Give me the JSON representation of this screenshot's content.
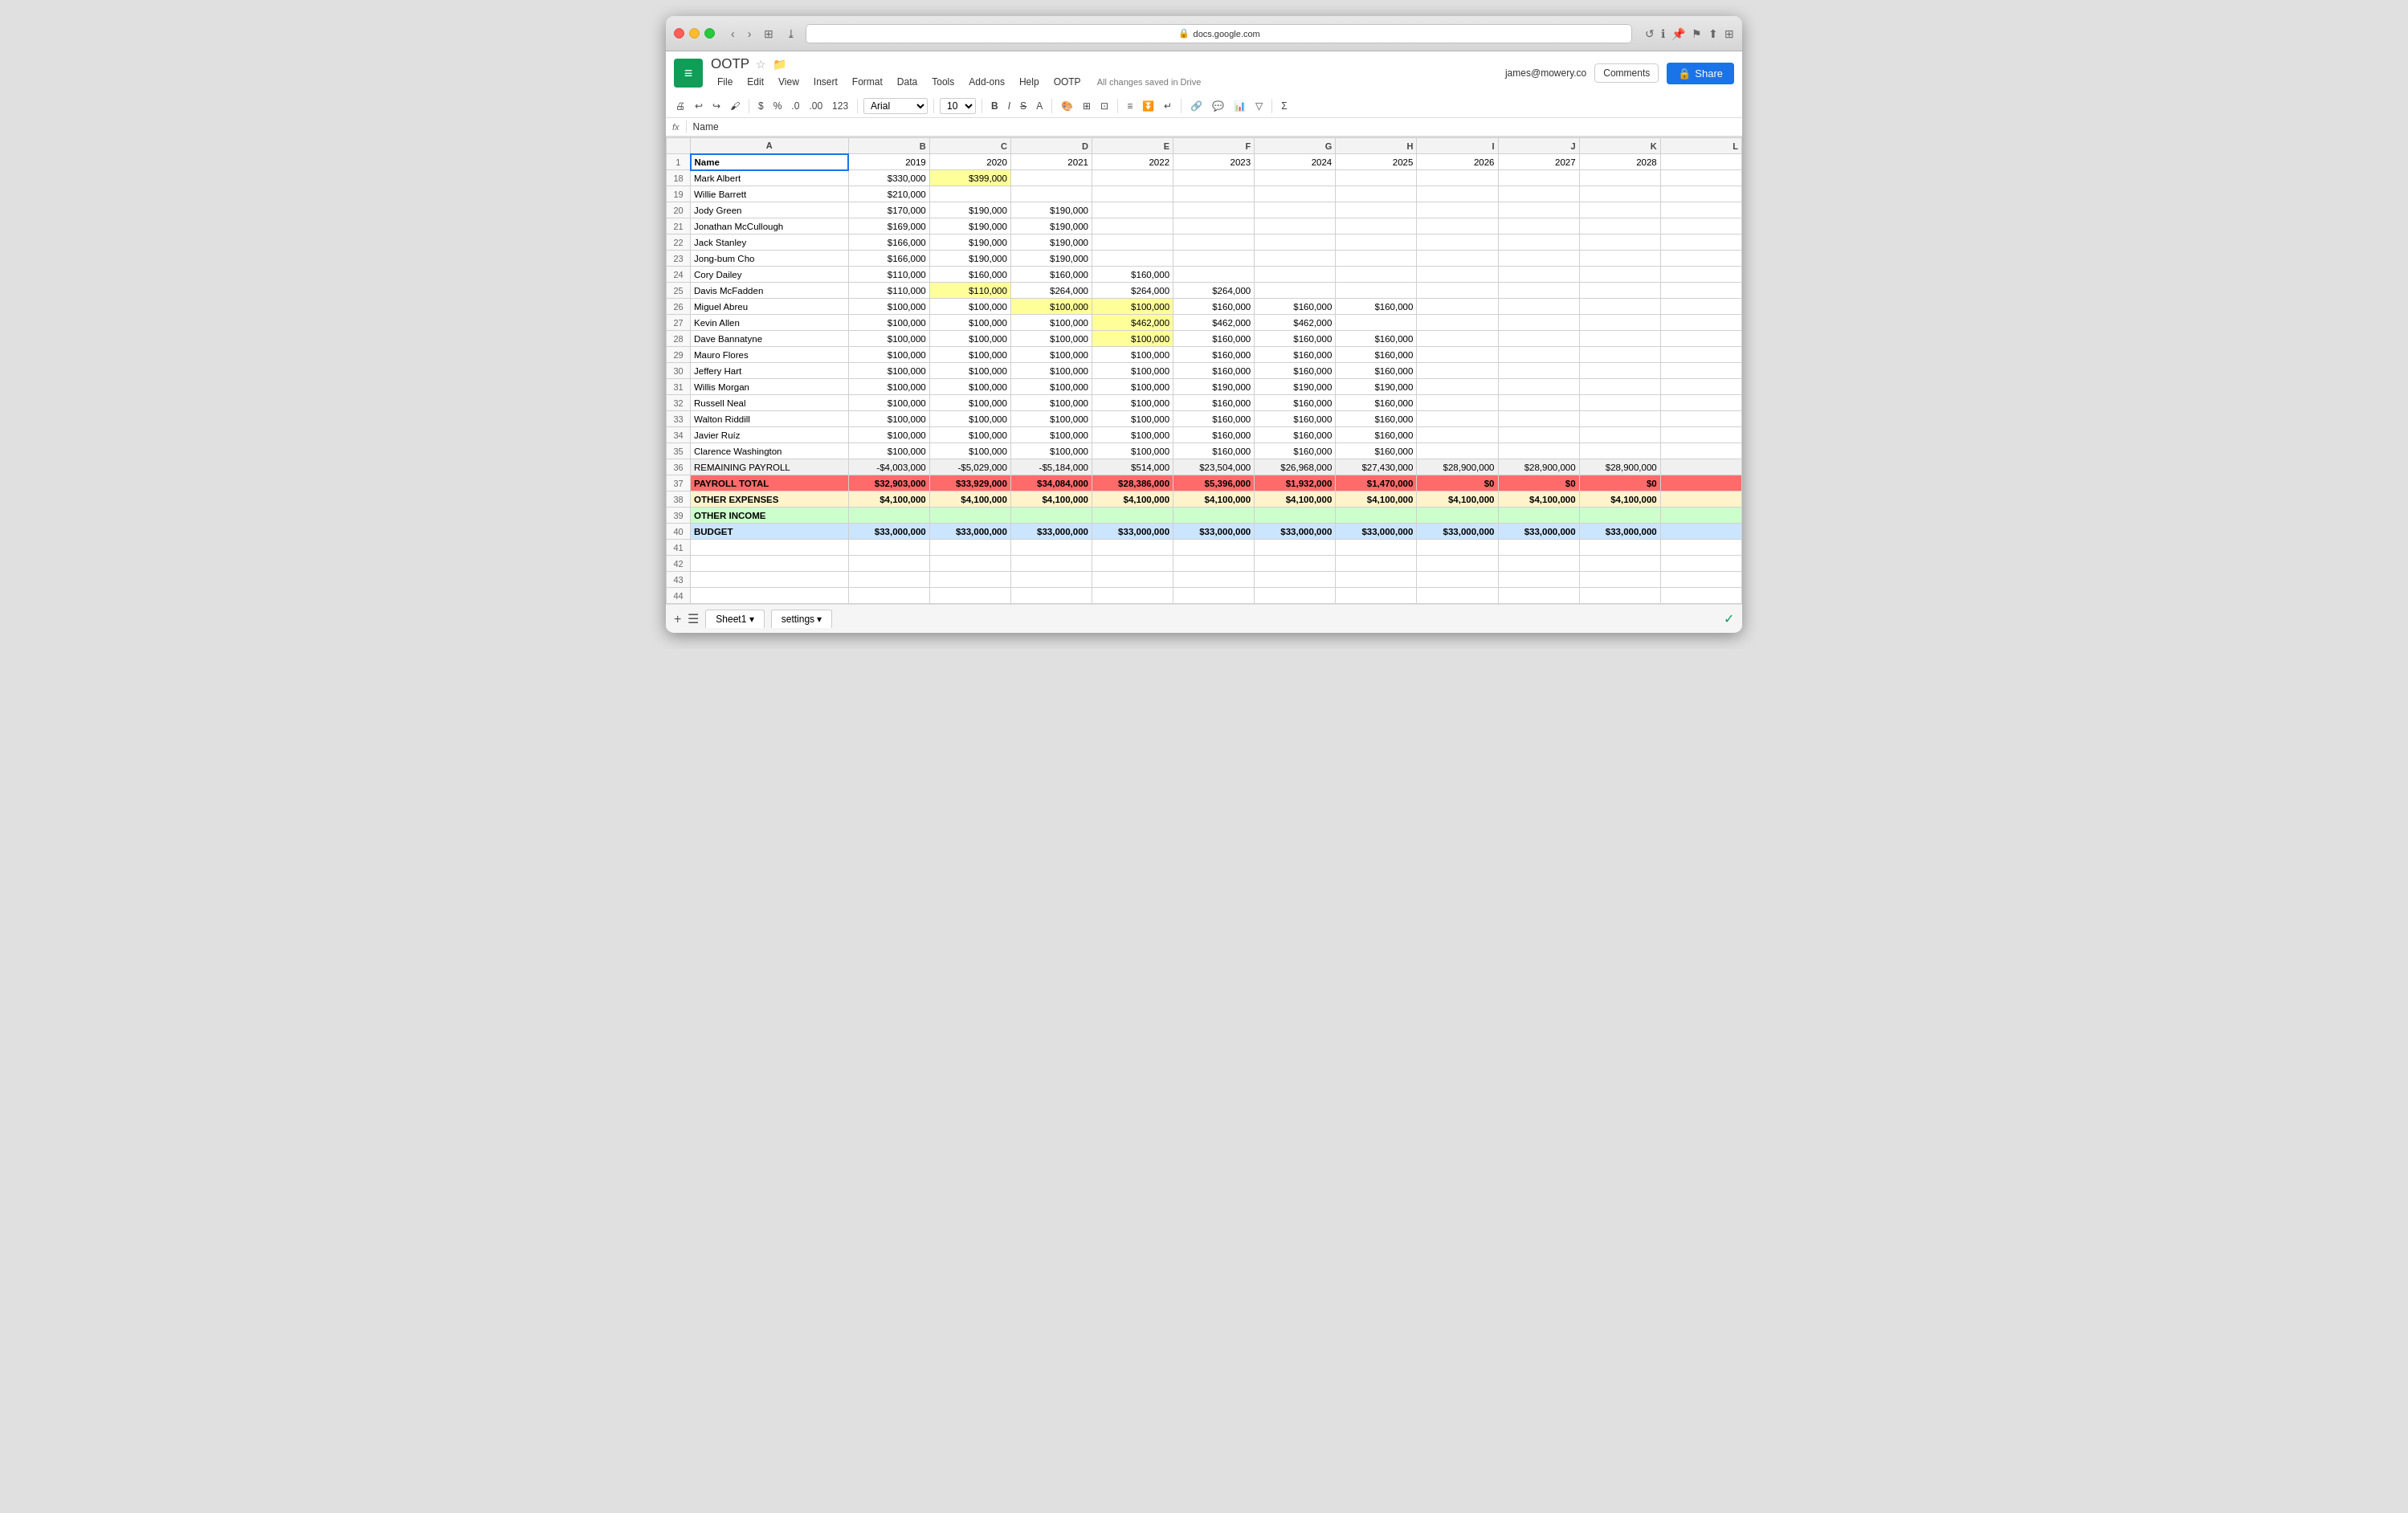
{
  "browser": {
    "url": "docs.google.com",
    "lock_icon": "🔒"
  },
  "header": {
    "logo_letter": "≡",
    "doc_title": "OOTP",
    "autosave": "All changes saved in Drive",
    "user_email": "james@mowery.co",
    "comments_label": "Comments",
    "share_label": "Share",
    "share_icon": "🔒"
  },
  "menu": {
    "items": [
      "File",
      "Edit",
      "View",
      "Insert",
      "Format",
      "Data",
      "Tools",
      "Add-ons",
      "Help",
      "OOTP"
    ]
  },
  "toolbar": {
    "font": "Arial",
    "size": "10"
  },
  "formula_bar": {
    "icon": "fx",
    "cell_ref": "Name"
  },
  "columns": {
    "headers": [
      "",
      "A",
      "B",
      "C",
      "D",
      "E",
      "F",
      "G",
      "H",
      "I",
      "J",
      "K",
      "L"
    ],
    "year_headers": [
      "Name",
      "2019",
      "2020",
      "2021",
      "2022",
      "2023",
      "2024",
      "2025",
      "2026",
      "2027",
      "2028",
      ""
    ]
  },
  "rows": [
    {
      "num": "18",
      "name": "Mark Albert",
      "b": "$330,000",
      "c": "$399,000",
      "c_yellow": true,
      "d": "",
      "e": "",
      "f": "",
      "g": "",
      "h": "",
      "i": "",
      "j": "",
      "k": ""
    },
    {
      "num": "19",
      "name": "Willie Barrett",
      "b": "$210,000",
      "c": "",
      "d": "",
      "e": "",
      "f": "",
      "g": "",
      "h": "",
      "i": "",
      "j": "",
      "k": ""
    },
    {
      "num": "20",
      "name": "Jody Green",
      "b": "$170,000",
      "c": "$190,000",
      "d": "$190,000",
      "e": "",
      "f": "",
      "g": "",
      "h": "",
      "i": "",
      "j": "",
      "k": ""
    },
    {
      "num": "21",
      "name": "Jonathan McCullough",
      "b": "$169,000",
      "c": "$190,000",
      "d": "$190,000",
      "e": "",
      "f": "",
      "g": "",
      "h": "",
      "i": "",
      "j": "",
      "k": ""
    },
    {
      "num": "22",
      "name": "Jack Stanley",
      "b": "$166,000",
      "c": "$190,000",
      "d": "$190,000",
      "e": "",
      "f": "",
      "g": "",
      "h": "",
      "i": "",
      "j": "",
      "k": ""
    },
    {
      "num": "23",
      "name": "Jong-bum Cho",
      "b": "$166,000",
      "c": "$190,000",
      "d": "$190,000",
      "e": "",
      "f": "",
      "g": "",
      "h": "",
      "i": "",
      "j": "",
      "k": ""
    },
    {
      "num": "24",
      "name": "Cory Dailey",
      "b": "$110,000",
      "c": "$160,000",
      "d": "$160,000",
      "e": "$160,000",
      "f": "",
      "g": "",
      "h": "",
      "i": "",
      "j": "",
      "k": ""
    },
    {
      "num": "25",
      "name": "Davis McFadden",
      "b": "$110,000",
      "c": "$110,000",
      "c_yellow": true,
      "d": "$264,000",
      "e": "$264,000",
      "f": "$264,000",
      "g": "",
      "h": "",
      "i": "",
      "j": "",
      "k": ""
    },
    {
      "num": "26",
      "name": "Miguel Abreu",
      "b": "$100,000",
      "c": "$100,000",
      "d": "$100,000",
      "d_yellow": true,
      "e": "$100,000",
      "e_yellow": true,
      "f": "$160,000",
      "g": "$160,000",
      "h": "$160,000",
      "i": "",
      "j": "",
      "k": ""
    },
    {
      "num": "27",
      "name": "Kevin Allen",
      "b": "$100,000",
      "c": "$100,000",
      "d": "$100,000",
      "e": "$462,000",
      "e_yellow": true,
      "f": "$462,000",
      "g": "$462,000",
      "h": "",
      "i": "",
      "j": "",
      "k": ""
    },
    {
      "num": "28",
      "name": "Dave Bannatyne",
      "b": "$100,000",
      "c": "$100,000",
      "d": "$100,000",
      "e": "$100,000",
      "e_yellow": true,
      "f": "$160,000",
      "g": "$160,000",
      "h": "$160,000",
      "i": "",
      "j": "",
      "k": ""
    },
    {
      "num": "29",
      "name": "Mauro Flores",
      "b": "$100,000",
      "c": "$100,000",
      "d": "$100,000",
      "e": "$100,000",
      "f": "$160,000",
      "g": "$160,000",
      "h": "$160,000",
      "i": "",
      "j": "",
      "k": ""
    },
    {
      "num": "30",
      "name": "Jeffery Hart",
      "b": "$100,000",
      "c": "$100,000",
      "d": "$100,000",
      "e": "$100,000",
      "f": "$160,000",
      "g": "$160,000",
      "h": "$160,000",
      "i": "",
      "j": "",
      "k": ""
    },
    {
      "num": "31",
      "name": "Willis Morgan",
      "b": "$100,000",
      "c": "$100,000",
      "d": "$100,000",
      "e": "$100,000",
      "f": "$190,000",
      "g": "$190,000",
      "h": "$190,000",
      "i": "",
      "j": "",
      "k": ""
    },
    {
      "num": "32",
      "name": "Russell Neal",
      "b": "$100,000",
      "c": "$100,000",
      "d": "$100,000",
      "e": "$100,000",
      "f": "$160,000",
      "g": "$160,000",
      "h": "$160,000",
      "i": "",
      "j": "",
      "k": ""
    },
    {
      "num": "33",
      "name": "Walton Riddill",
      "b": "$100,000",
      "c": "$100,000",
      "d": "$100,000",
      "e": "$100,000",
      "f": "$160,000",
      "g": "$160,000",
      "h": "$160,000",
      "i": "",
      "j": "",
      "k": ""
    },
    {
      "num": "34",
      "name": "Javier Ruíz",
      "b": "$100,000",
      "c": "$100,000",
      "d": "$100,000",
      "e": "$100,000",
      "f": "$160,000",
      "g": "$160,000",
      "h": "$160,000",
      "i": "",
      "j": "",
      "k": ""
    },
    {
      "num": "35",
      "name": "Clarence Washington",
      "b": "$100,000",
      "c": "$100,000",
      "d": "$100,000",
      "e": "$100,000",
      "f": "$160,000",
      "g": "$160,000",
      "h": "$160,000",
      "i": "",
      "j": "",
      "k": ""
    },
    {
      "num": "36",
      "name": "REMAINING PAYROLL",
      "b": "-$4,003,000",
      "c": "-$5,029,000",
      "d": "-$5,184,000",
      "e": "$514,000",
      "f": "$23,504,000",
      "g": "$26,968,000",
      "h": "$27,430,000",
      "i": "$28,900,000",
      "j": "$28,900,000",
      "k": "$28,900,000",
      "type": "remaining"
    },
    {
      "num": "37",
      "name": "PAYROLL TOTAL",
      "b": "$32,903,000",
      "c": "$33,929,000",
      "d": "$34,084,000",
      "e": "$28,386,000",
      "f": "$5,396,000",
      "g": "$1,932,000",
      "h": "$1,470,000",
      "i": "$0",
      "j": "$0",
      "k": "$0",
      "type": "payroll"
    },
    {
      "num": "38",
      "name": "OTHER EXPENSES",
      "b": "$4,100,000",
      "c": "$4,100,000",
      "d": "$4,100,000",
      "e": "$4,100,000",
      "f": "$4,100,000",
      "g": "$4,100,000",
      "h": "$4,100,000",
      "i": "$4,100,000",
      "j": "$4,100,000",
      "k": "$4,100,000",
      "type": "other_exp"
    },
    {
      "num": "39",
      "name": "OTHER INCOME",
      "b": "",
      "c": "",
      "d": "",
      "e": "",
      "f": "",
      "g": "",
      "h": "",
      "i": "",
      "j": "",
      "k": "",
      "type": "other_inc"
    },
    {
      "num": "40",
      "name": "BUDGET",
      "b": "$33,000,000",
      "c": "$33,000,000",
      "d": "$33,000,000",
      "e": "$33,000,000",
      "f": "$33,000,000",
      "g": "$33,000,000",
      "h": "$33,000,000",
      "i": "$33,000,000",
      "j": "$33,000,000",
      "k": "$33,000,000",
      "type": "budget"
    },
    {
      "num": "41",
      "name": "",
      "b": "",
      "c": "",
      "d": "",
      "e": "",
      "f": "",
      "g": "",
      "h": "",
      "i": "",
      "j": "",
      "k": ""
    },
    {
      "num": "42",
      "name": "",
      "b": "",
      "c": "",
      "d": "",
      "e": "",
      "f": "",
      "g": "",
      "h": "",
      "i": "",
      "j": "",
      "k": ""
    },
    {
      "num": "43",
      "name": "",
      "b": "",
      "c": "",
      "d": "",
      "e": "",
      "f": "",
      "g": "",
      "h": "",
      "i": "",
      "j": "",
      "k": ""
    },
    {
      "num": "44",
      "name": "",
      "b": "",
      "c": "",
      "d": "",
      "e": "",
      "f": "",
      "g": "",
      "h": "",
      "i": "",
      "j": "",
      "k": ""
    }
  ],
  "bottom": {
    "sheet1": "Sheet1",
    "settings": "settings",
    "add_icon": "+",
    "list_icon": "☰"
  }
}
